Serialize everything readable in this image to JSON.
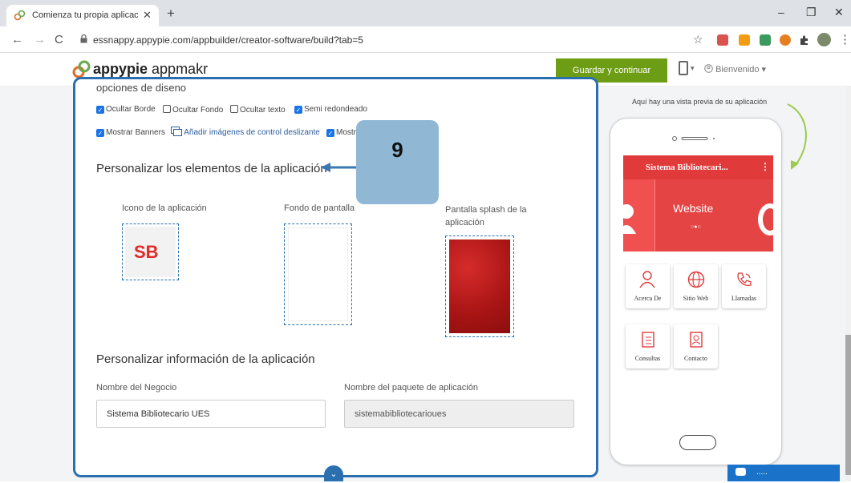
{
  "browser": {
    "tab_title": "Comienza tu propia aplicación en",
    "tab_close": "✕",
    "new_tab": "+",
    "url": "essnappy.appypie.com/appbuilder/creator-software/build?tab=5",
    "back": "←",
    "forward": "→",
    "reload": "C",
    "minimize": "–",
    "restore": "❐",
    "close": "✕",
    "star": "☆",
    "menu": "⋮"
  },
  "header": {
    "logo_bold": "appypie",
    "logo_light": " appmakr",
    "save_button": "Guardar y continuar",
    "device_caret": "▾",
    "welcome": "Bienvenido ▾"
  },
  "design": {
    "title": "opciones de diseno",
    "row1": [
      {
        "label": "Ocultar Borde",
        "checked": true
      },
      {
        "label": "Ocultar Fondo",
        "checked": false
      },
      {
        "label": "Ocultar texto",
        "checked": false
      },
      {
        "label": "Semi redondeado",
        "checked": true
      }
    ],
    "row2_banners": "Mostrar Banners",
    "row2_link": "Añadir imágenes de control deslizante",
    "row2_more": "Mostr"
  },
  "callout": {
    "number": "9"
  },
  "elements": {
    "title": "Personalizar los elementos de la aplicación",
    "icon_label": "Icono de la aplicación",
    "icon_text": "SB",
    "wallpaper_label": "Fondo de pantalla",
    "splash_label": "Pantalla splash de la aplicación"
  },
  "info": {
    "title": "Personalizar información de la aplicación",
    "business_label": "Nombre del Negocio",
    "business_value": "Sistema Bibliotecario UES",
    "package_label": "Nombre del paquete de aplicación",
    "package_value": "sistemabibliotecarioues"
  },
  "preview": {
    "caption": "Aquí hay una vista previa de su aplicación",
    "app_title": "Sistema Bibliotecari...",
    "menu_dots": "⋮",
    "banner_text": "Website",
    "banner_dots": "○●○",
    "tiles": [
      "Acerca De",
      "Sitio Web",
      "Llamadas",
      "Consultas",
      "Contacto"
    ]
  },
  "chat": {
    "text": "....."
  },
  "scroll_down": "⌄",
  "colors": {
    "accent_blue": "#2a6fb0",
    "save_green": "#6d9d14",
    "app_red": "#e13a3a",
    "callout": "#90b8d5"
  }
}
